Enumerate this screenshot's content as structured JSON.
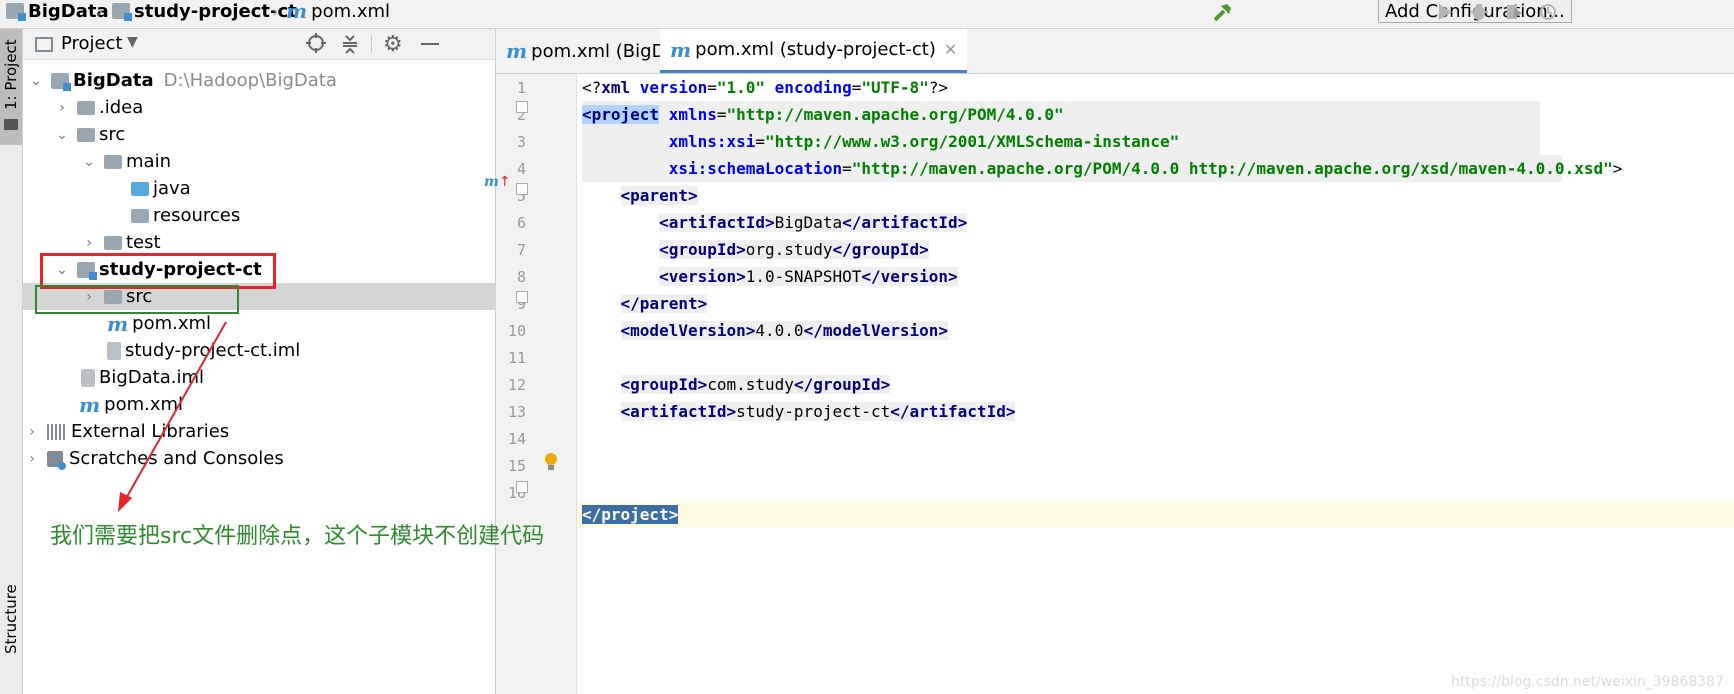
{
  "breadcrumb": {
    "project": "BigData",
    "module": "study-project-ct",
    "file": "pom.xml"
  },
  "toolbar": {
    "add_configuration": "Add Configuration..."
  },
  "left_strip": {
    "project_tab": "1: Project",
    "structure_tab": "Structure"
  },
  "project_panel": {
    "title": "Project"
  },
  "tree": {
    "root_name": "BigData",
    "root_path": "D:\\Hadoop\\BigData",
    "idea": ".idea",
    "src": "src",
    "main": "main",
    "java": "java",
    "resources": "resources",
    "test": "test",
    "module": "study-project-ct",
    "module_src": "src",
    "module_pom": "pom.xml",
    "module_iml": "study-project-ct.iml",
    "root_iml": "BigData.iml",
    "root_pom": "pom.xml",
    "ext_libs": "External Libraries",
    "scratches": "Scratches and Consoles"
  },
  "tabs": [
    {
      "label": "pom.xml (BigData)"
    },
    {
      "label": "pom.xml (study-project-ct)"
    }
  ],
  "annotation": "我们需要把src文件删除点，这个子模块不创建代码",
  "watermark": "https://blog.csdn.net/weixin_39868387",
  "colors": {
    "tag": "#000080",
    "attr": "#0000ff",
    "value": "#008000",
    "red_box": "#e8242a",
    "green_box": "#2e8b2e",
    "annotation": "#2e8b2e"
  },
  "code": {
    "l1_a": "<?",
    "l1_b": "xml ",
    "l1_c": "version",
    "l1_d": "=",
    "l1_e": "\"1.0\" ",
    "l1_f": "encoding",
    "l1_g": "=",
    "l1_h": "\"UTF-8\"",
    "l1_i": "?>",
    "l2_tag": "<project",
    "l2_attr": "xmlns",
    "l2_val": "\"http://maven.apache.org/POM/4.0.0\"",
    "l3_attr": "xmlns:xsi",
    "l3_val": "\"http://www.w3.org/2001/XMLSchema-instance\"",
    "l4_attr": "xsi:schemaLocation",
    "l4_val": "\"http://maven.apache.org/POM/4.0.0 http://maven.apache.org/xsd/maven-4.0.0.xsd\"",
    "l4_end": ">",
    "l5": "<parent>",
    "l6_o": "<artifactId>",
    "l6_t": "BigData",
    "l6_c": "</artifactId>",
    "l7_o": "<groupId>",
    "l7_t": "org.study",
    "l7_c": "</groupId>",
    "l8_o": "<version>",
    "l8_t": "1.0-SNAPSHOT",
    "l8_c": "</version>",
    "l9": "</parent>",
    "l10_o": "<modelVersion>",
    "l10_t": "4.0.0",
    "l10_c": "</modelVersion>",
    "l12_o": "<groupId>",
    "l12_t": "com.study",
    "l12_c": "</groupId>",
    "l13_o": "<artifactId>",
    "l13_t": "study-project-ct",
    "l13_c": "</artifactId>",
    "l16": "</project>"
  },
  "line_numbers": [
    "1",
    "2",
    "3",
    "4",
    "5",
    "6",
    "7",
    "8",
    "9",
    "10",
    "11",
    "12",
    "13",
    "14",
    "15",
    "16"
  ]
}
